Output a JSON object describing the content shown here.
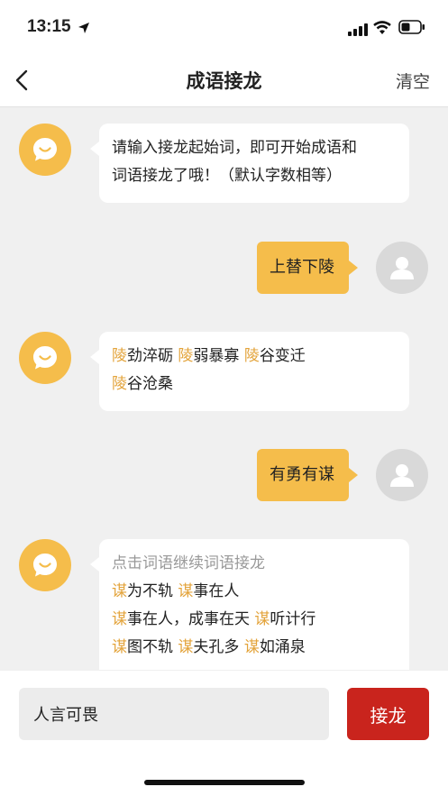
{
  "status_bar": {
    "time": "13:15"
  },
  "nav": {
    "title": "成语接龙",
    "clear_label": "清空"
  },
  "colors": {
    "accent": "#f5bd4b",
    "highlight": "#e3a33a",
    "send_button": "#c9241d"
  },
  "messages": {
    "m1": {
      "line1": "请输入接龙起始词，即可开始成语和",
      "line2": "词语接龙了哦！（默认字数相等）"
    },
    "m2": {
      "text": "上替下陵"
    },
    "m3": {
      "w1a": "陵",
      "w1b": "劲淬砺",
      "w2a": "陵",
      "w2b": "弱暴寡",
      "w3a": "陵",
      "w3b": "谷变迁",
      "w4a": "陵",
      "w4b": "谷沧桑"
    },
    "m4": {
      "text": "有勇有谋"
    },
    "m5": {
      "hint": "点击词语继续词语接龙",
      "w1a": "谋",
      "w1b": "为不轨",
      "w2a": "谋",
      "w2b": "事在人",
      "w3a": "谋",
      "w3b": "事在人，成事在天",
      "w4a": "谋",
      "w4b": "听计行",
      "w5a": "谋",
      "w5b": "图不轨",
      "w6a": "谋",
      "w6b": "夫孔多",
      "w7a": "谋",
      "w7b": "如涌泉"
    }
  },
  "input": {
    "value": "人言可畏",
    "send_label": "接龙"
  }
}
